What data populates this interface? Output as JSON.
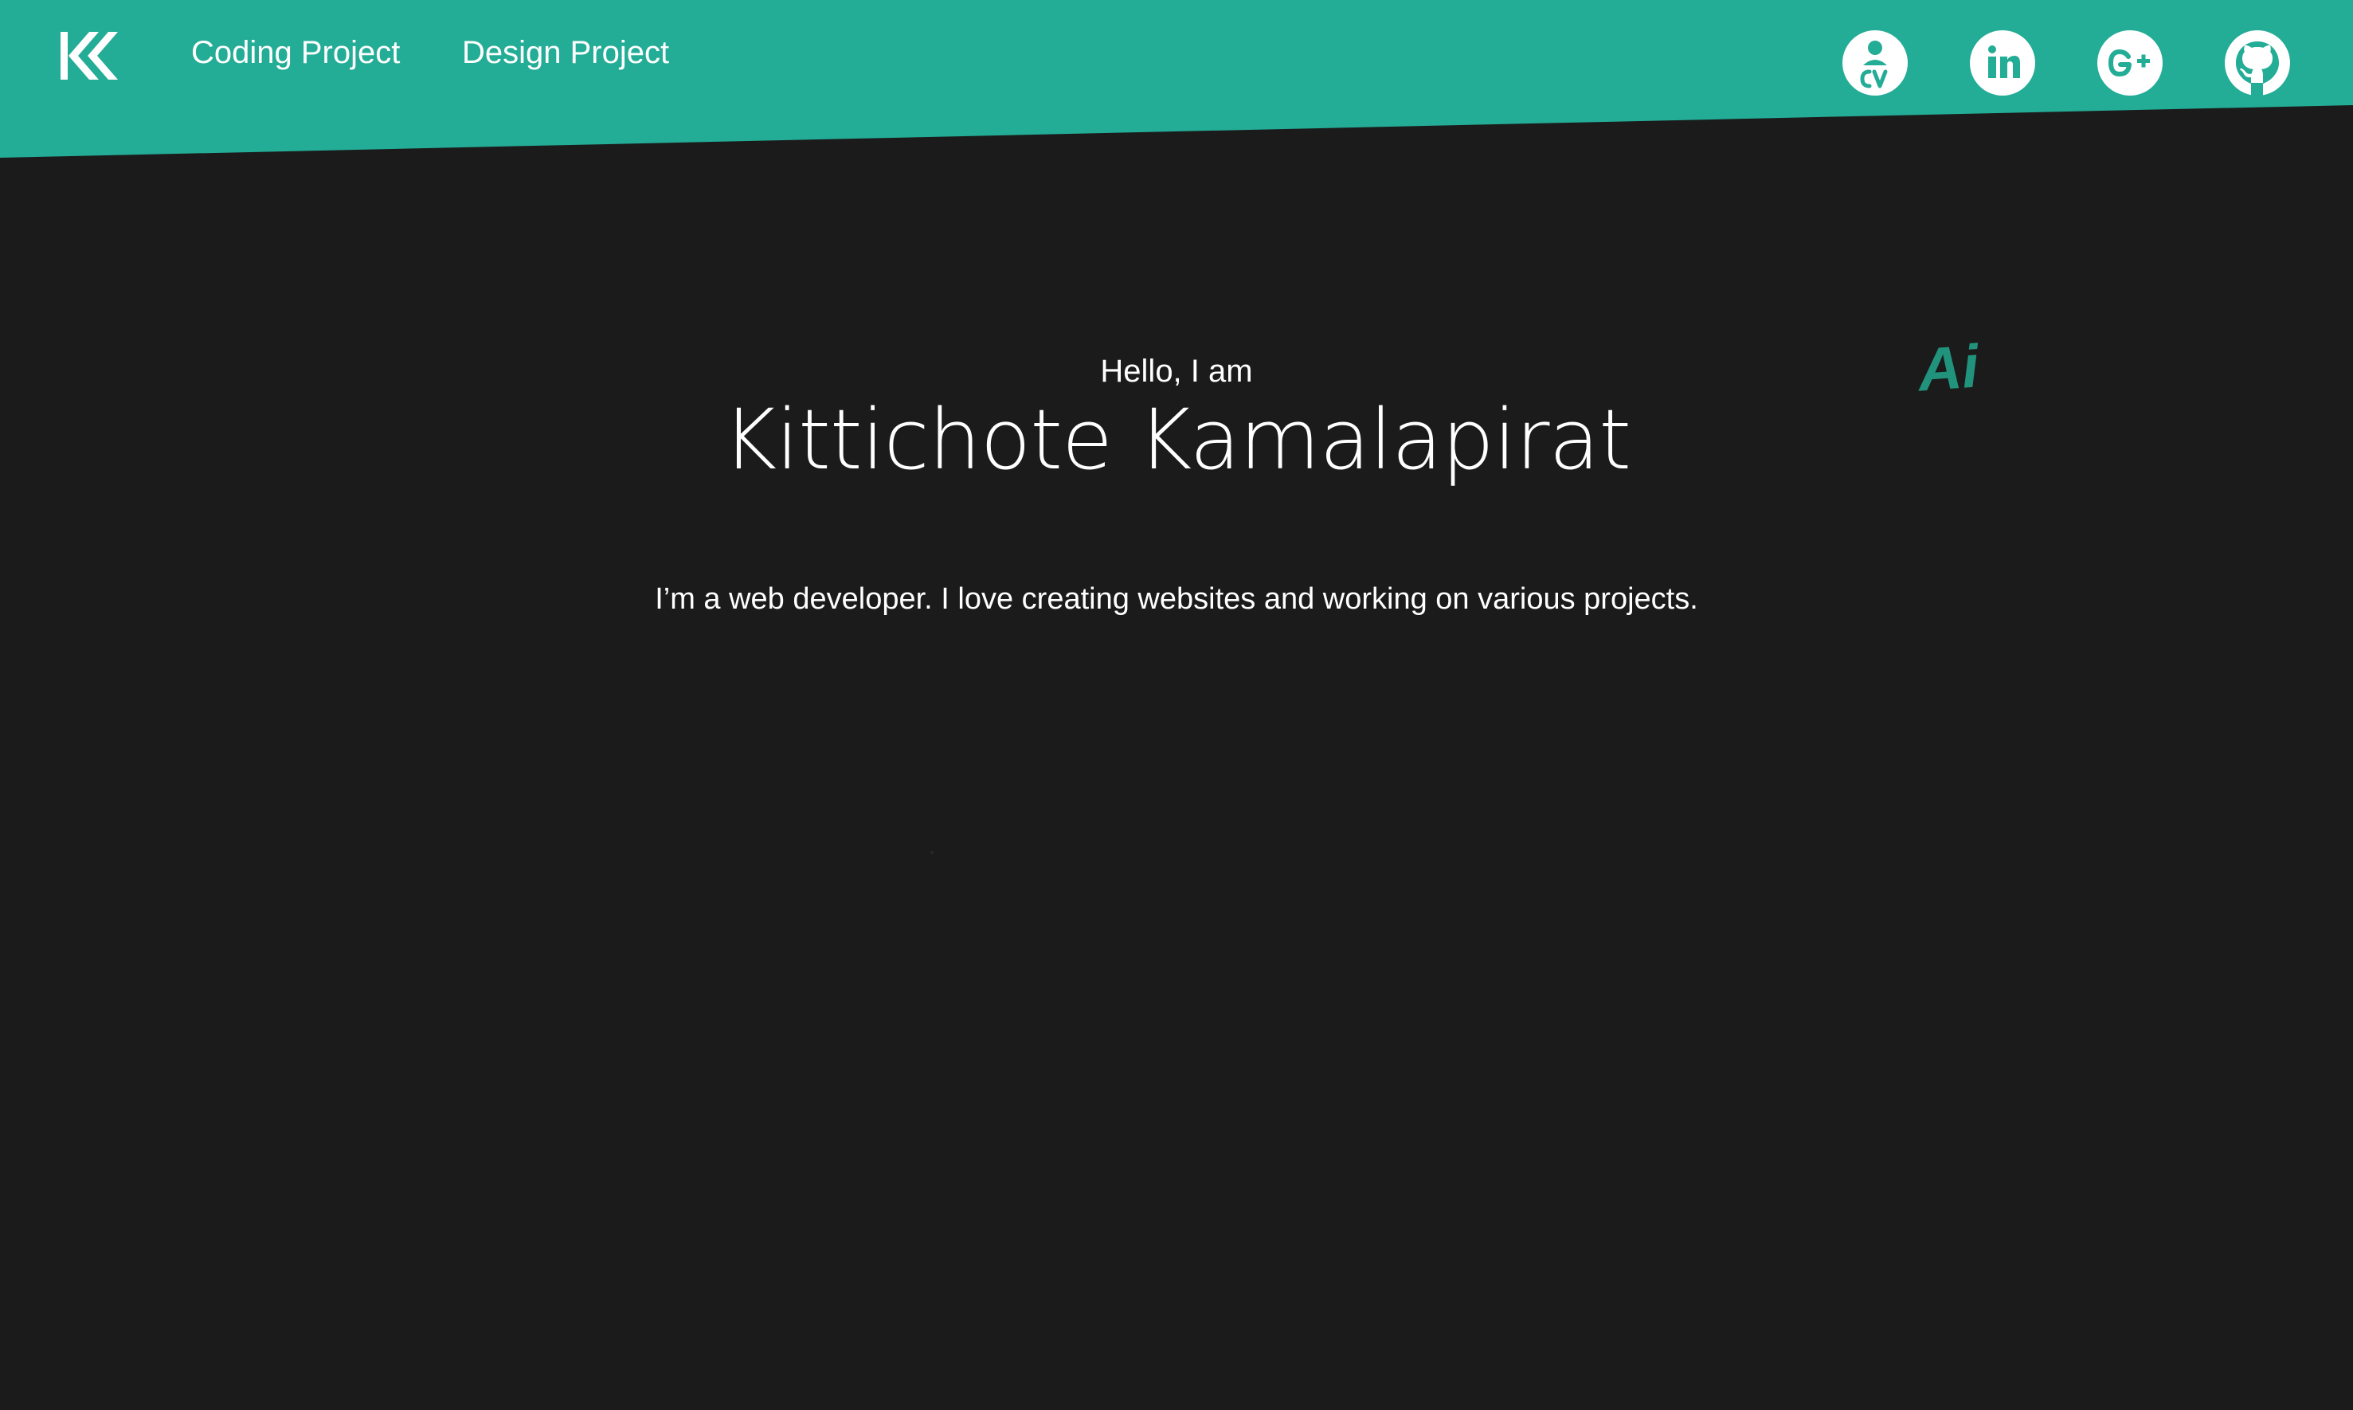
{
  "colors": {
    "accent": "#23ac96",
    "background": "#1b1b1b",
    "text": "#ffffff"
  },
  "header": {
    "logo_icon": "kk-logo-icon",
    "nav": [
      {
        "label": "Coding Project"
      },
      {
        "label": "Design Project"
      }
    ],
    "social": [
      {
        "icon": "cv-icon"
      },
      {
        "icon": "linkedin-icon"
      },
      {
        "icon": "google-plus-icon"
      },
      {
        "icon": "github-icon"
      }
    ]
  },
  "hero": {
    "greeting": "Hello, I am",
    "name": "Kittichote Kamalapirat",
    "tagline": "I’m a web developer. I love creating websites and working on various projects.",
    "floating_mark": "Ai"
  }
}
